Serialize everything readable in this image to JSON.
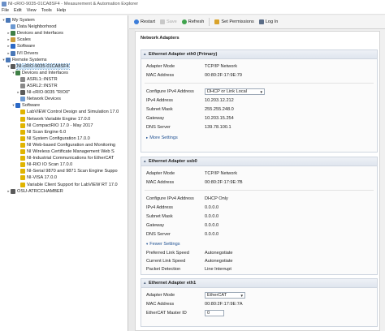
{
  "window": {
    "title": "NI-cRIO-9035-01CA8SF4 - Measurement & Automation Explorer"
  },
  "menu": [
    "File",
    "Edit",
    "View",
    "Tools",
    "Help"
  ],
  "tree": [
    {
      "label": "My System",
      "indent": 0,
      "exp": "▾",
      "color": "#4a78b8"
    },
    {
      "label": "Data Neighborhood",
      "indent": 1,
      "exp": "",
      "color": "#6d9ad3"
    },
    {
      "label": "Devices and Interfaces",
      "indent": 1,
      "exp": "▸",
      "color": "#3f7f45"
    },
    {
      "label": "Scales",
      "indent": 1,
      "exp": "▸",
      "color": "#c99c3a"
    },
    {
      "label": "Software",
      "indent": 1,
      "exp": "▸",
      "color": "#2b69c6"
    },
    {
      "label": "IVI Drivers",
      "indent": 1,
      "exp": "▸",
      "color": "#4a78b8"
    },
    {
      "label": "Remote Systems",
      "indent": 0,
      "exp": "▾",
      "color": "#4a78b8"
    },
    {
      "label": "NI-cRIO-9035-01CA8SF4",
      "indent": 1,
      "exp": "▾",
      "color": "#5a5a5a",
      "selected": true
    },
    {
      "label": "Devices and Interfaces",
      "indent": 2,
      "exp": "▾",
      "color": "#3f7f45"
    },
    {
      "label": "ASRL1::INSTR",
      "indent": 3,
      "exp": "",
      "color": "#8a8a8a"
    },
    {
      "label": "ASRL2::INSTR",
      "indent": 3,
      "exp": "",
      "color": "#8a8a8a"
    },
    {
      "label": "NI-cRIO-9035 \"RIO0\"",
      "indent": 3,
      "exp": "▸",
      "color": "#5a5a5a"
    },
    {
      "label": "Network Devices",
      "indent": 3,
      "exp": "",
      "color": "#6d9ad3"
    },
    {
      "label": "Software",
      "indent": 2,
      "exp": "▾",
      "color": "#2b69c6"
    },
    {
      "label": "LabVIEW Control Design and Simulation 17.0",
      "indent": 3,
      "exp": "",
      "color": "#e0b400"
    },
    {
      "label": "Network Variable Engine 17.0.0",
      "indent": 3,
      "exp": "",
      "color": "#e0b400"
    },
    {
      "label": "NI CompactRIO 17.0 - May 2017",
      "indent": 3,
      "exp": "",
      "color": "#e0b400"
    },
    {
      "label": "NI Scan Engine 6.0",
      "indent": 3,
      "exp": "",
      "color": "#e0b400"
    },
    {
      "label": "NI System Configuration 17.0.0",
      "indent": 3,
      "exp": "",
      "color": "#e0b400"
    },
    {
      "label": "NI Web-based Configuration and Monitoring",
      "indent": 3,
      "exp": "",
      "color": "#e0b400"
    },
    {
      "label": "NI Wireless Certificate Management Web S",
      "indent": 3,
      "exp": "",
      "color": "#e0b400"
    },
    {
      "label": "NI-Industrial Communications for EtherCAT",
      "indent": 3,
      "exp": "",
      "color": "#e0b400"
    },
    {
      "label": "NI-RIO IO Scan 17.0.0",
      "indent": 3,
      "exp": "",
      "color": "#e0b400"
    },
    {
      "label": "NI-Serial 9870 and 9871 Scan Engine Suppo",
      "indent": 3,
      "exp": "",
      "color": "#e0b400"
    },
    {
      "label": "NI-VISA 17.0.0",
      "indent": 3,
      "exp": "",
      "color": "#e0b400"
    },
    {
      "label": "Variable Client Support for LabVIEW RT 17.0",
      "indent": 3,
      "exp": "",
      "color": "#e0b400"
    },
    {
      "label": "OSU-ATRCCHAMBER",
      "indent": 1,
      "exp": "▸",
      "color": "#5a5a5a"
    }
  ],
  "toolbar": {
    "restart": "Restart",
    "save": "Save",
    "refresh": "Refresh",
    "set_permissions": "Set Permissions",
    "log_in": "Log In"
  },
  "content": {
    "section_title": "Network Adapters",
    "eth0": {
      "title": "Ethernet Adapter eth0 (Primary)",
      "adapter_mode_label": "Adapter Mode",
      "adapter_mode": "TCP/IP Network",
      "mac_label": "MAC Address",
      "mac": "00:80:2F:17:9E:79",
      "config_label": "Configure IPv4 Address",
      "config_value": "DHCP or Link Local",
      "ipv4_label": "IPv4 Address",
      "ipv4": "10.203.12.212",
      "subnet_label": "Subnet Mask",
      "subnet": "255.255.248.0",
      "gateway_label": "Gateway",
      "gateway": "10.203.15.254",
      "dns_label": "DNS Server",
      "dns": "139.78.100.1",
      "more_settings": "More Settings"
    },
    "usb0": {
      "title": "Ethernet Adapter usb0",
      "adapter_mode_label": "Adapter Mode",
      "adapter_mode": "TCP/IP Network",
      "mac_label": "MAC Address",
      "mac": "00:80:2F:17:9E:7B",
      "config_label": "Configure IPv4 Address",
      "config_value": "DHCP Only",
      "ipv4_label": "IPv4 Address",
      "ipv4": "0.0.0.0",
      "subnet_label": "Subnet Mask",
      "subnet": "0.0.0.0",
      "gateway_label": "Gateway",
      "gateway": "0.0.0.0",
      "dns_label": "DNS Server",
      "dns": "0.0.0.0",
      "fewer_settings": "Fewer Settings",
      "link_speed_label": "Preferred Link Speed",
      "link_speed": "Autonegotiate",
      "current_speed_label": "Current Link Speed",
      "current_speed": "Autonegotiate",
      "packet_label": "Packet Detection",
      "packet": "Line Interrupt"
    },
    "eth1": {
      "title": "Ethernet Adapter eth1",
      "adapter_mode_label": "Adapter Mode",
      "adapter_mode": "EtherCAT",
      "mac_label": "MAC Address",
      "mac": "00:80:2F:17:9E:7A",
      "master_label": "EtherCAT Master ID",
      "master": "0"
    }
  }
}
